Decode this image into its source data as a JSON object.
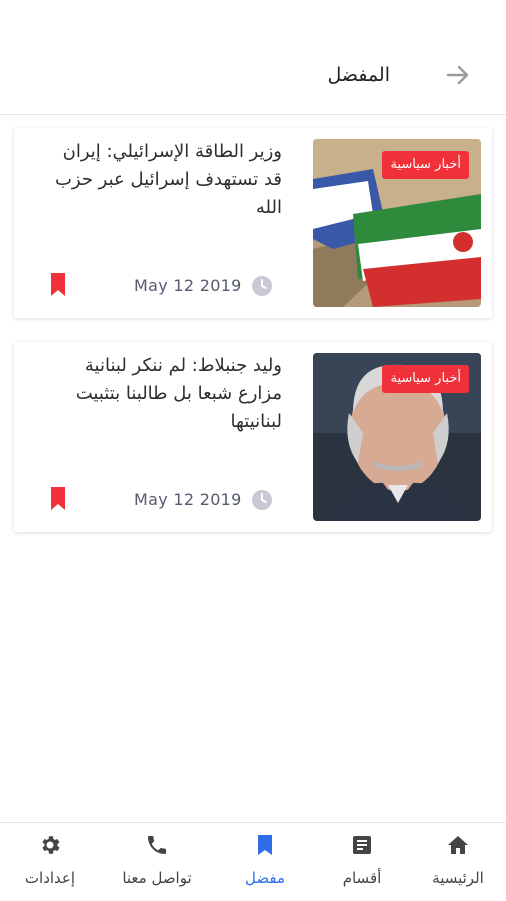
{
  "header": {
    "title": "المفضل",
    "back_icon": "arrow-right-icon"
  },
  "articles": [
    {
      "category": "أخبار سياسية",
      "title": "وزير الطاقة الإسرائيلي: إيران قد تستهدف إسرائيل عبر حزب الله",
      "date": "May 12 2019",
      "image": "iran-israel-flags-photo"
    },
    {
      "category": "أخبار سياسية",
      "title": "وليد جنبلاط: لم ننكر لبنانية مزارع شبعا بل طالبنا بتثبيت لبنانيتها",
      "date": "May 12 2019",
      "image": "portrait-photo"
    }
  ],
  "nav": [
    {
      "label": "الرئيسية",
      "icon": "home-icon"
    },
    {
      "label": "أقسام",
      "icon": "article-icon"
    },
    {
      "label": "مفضل",
      "icon": "bookmark-icon",
      "active": true
    },
    {
      "label": "تواصل معنا",
      "icon": "phone-icon"
    },
    {
      "label": "إعدادات",
      "icon": "gear-icon"
    }
  ],
  "colors": {
    "accent": "#2f6de8",
    "badge": "#f0313a",
    "bookmark": "#f0313a"
  }
}
